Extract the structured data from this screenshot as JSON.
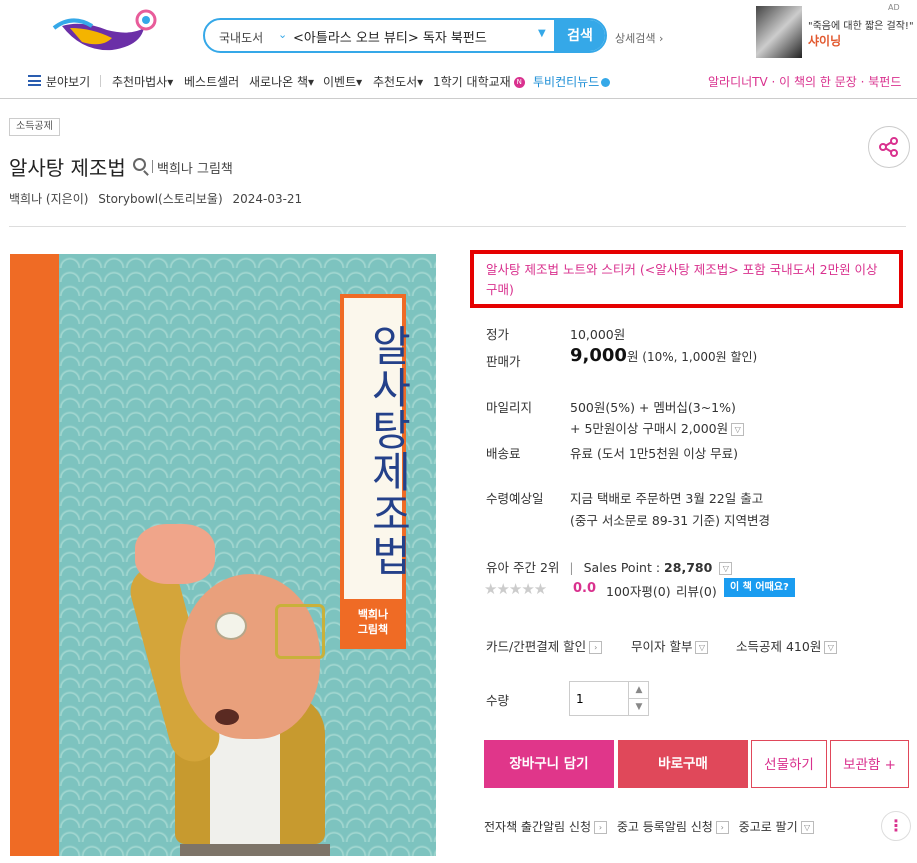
{
  "header": {
    "search": {
      "category": "국내도서",
      "query": "<아틀라스 오브 뷰티> 독자 북펀드",
      "button": "검색"
    },
    "advanced_search": "상세검색",
    "ad": {
      "mark": "AD",
      "line1": "\"죽음에 대한 짧은 걸작!\"",
      "line2": "샤이닝"
    }
  },
  "nav": {
    "items": [
      "분야보기",
      "추천마법사",
      "베스트셀러",
      "새로나온 책",
      "이벤트",
      "추천도서",
      "1학기 대학교재",
      "투비컨티뉴드"
    ],
    "new_badge": "N",
    "right": "알라디너TV · 이 책의 한 문장 · 북펀드"
  },
  "book": {
    "tag": "소득공제",
    "title": "알사탕 제조법",
    "subtitle": "백희나 그림책",
    "author": "백희나 (지은이)",
    "publisher": "Storybowl(스토리보울)",
    "date": "2024-03-21",
    "cover": {
      "title": "알사탕제조법",
      "author_line1": "백희나",
      "author_line2": "그림책"
    }
  },
  "detail": {
    "promo": "알사탕 제조법 노트와 스티커 (<알사탕 제조법> 포함 국내도서 2만원 이상 구매)",
    "list_price_label": "정가",
    "list_price": "10,000원",
    "sale_price_label": "판매가",
    "sale_price": "9,000",
    "sale_unit": "원",
    "discount": "(10%, 1,000원 할인)",
    "mileage_label": "마일리지",
    "mileage_line1": "500원(5%) + 멤버십(3~1%)",
    "mileage_line2": "+ 5만원이상 구매시 2,000원",
    "shipping_label": "배송료",
    "shipping": "유료 (도서 1만5천원 이상 무료)",
    "delivery_label": "수령예상일",
    "delivery_line1": "지금 택배로 주문하면 3월 22일 출고",
    "delivery_line2": "(중구 서소문로 89-31 기준) 지역변경",
    "rank": "유아 주간 2위",
    "sales_point_label": "Sales Point :",
    "sales_point": "28,780",
    "rating": "0.0",
    "review_count": "100자평(0)",
    "review": "리뷰(0)",
    "how_badge": "이 책 어때요?",
    "card_discount": "카드/간편결제 할인",
    "installment": "무이자 할부",
    "tax_deduction": "소득공제 410원",
    "qty_label": "수량",
    "qty": "1",
    "btn_cart": "장바구니 담기",
    "btn_buy": "바로구매",
    "btn_gift": "선물하기",
    "btn_save": "보관함 +",
    "link_ebook": "전자책 출간알림 신청",
    "link_used": "중고 등록알림 신청",
    "link_sell": "중고로 팔기"
  }
}
